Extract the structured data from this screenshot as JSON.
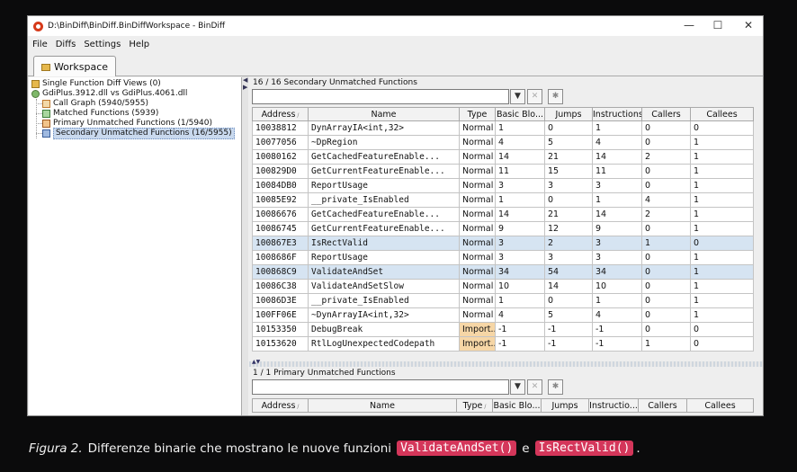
{
  "window": {
    "title": "D:\\BinDiff\\BinDiff.BinDiffWorkspace - BinDiff",
    "controls": {
      "minimize": "—",
      "maximize": "☐",
      "close": "✕"
    }
  },
  "menu": [
    "File",
    "Diffs",
    "Settings",
    "Help"
  ],
  "tab": {
    "label": "Workspace"
  },
  "tree": {
    "single_views": "Single Function Diff Views (0)",
    "diff_root": "GdiPlus.3912.dll vs GdiPlus.4061.dll",
    "call_graph": "Call Graph (5940/5955)",
    "matched": "Matched Functions (5939)",
    "primary_unmatched": "Primary Unmatched Functions (1/5940)",
    "secondary_unmatched": "Secondary Unmatched Functions (16/5955)"
  },
  "secondary_panel": {
    "title": "16 / 16 Secondary Unmatched Functions",
    "columns": [
      "Address",
      "Name",
      "Type",
      "Basic Blo...",
      "Jumps",
      "Instructions",
      "Callers",
      "Callees"
    ],
    "rows": [
      [
        "10038812",
        "DynArrayIA<int,32>",
        "Normal",
        "1",
        "0",
        "1",
        "0",
        "0"
      ],
      [
        "10077056",
        "~DpRegion",
        "Normal",
        "4",
        "5",
        "4",
        "0",
        "1"
      ],
      [
        "10080162",
        "GetCachedFeatureEnable...",
        "Normal",
        "14",
        "21",
        "14",
        "2",
        "1"
      ],
      [
        "100829D0",
        "GetCurrentFeatureEnable...",
        "Normal",
        "11",
        "15",
        "11",
        "0",
        "1"
      ],
      [
        "10084DB0",
        "ReportUsage",
        "Normal",
        "3",
        "3",
        "3",
        "0",
        "1"
      ],
      [
        "10085E92",
        "__private_IsEnabled",
        "Normal",
        "1",
        "0",
        "1",
        "4",
        "1"
      ],
      [
        "10086676",
        "GetCachedFeatureEnable...",
        "Normal",
        "14",
        "21",
        "14",
        "2",
        "1"
      ],
      [
        "10086745",
        "GetCurrentFeatureEnable...",
        "Normal",
        "9",
        "12",
        "9",
        "0",
        "1"
      ],
      [
        "100867E3",
        "IsRectValid",
        "Normal",
        "3",
        "2",
        "3",
        "1",
        "0"
      ],
      [
        "1008686F",
        "ReportUsage",
        "Normal",
        "3",
        "3",
        "3",
        "0",
        "1"
      ],
      [
        "100868C9",
        "ValidateAndSet",
        "Normal",
        "34",
        "54",
        "34",
        "0",
        "1"
      ],
      [
        "10086C38",
        "ValidateAndSetSlow",
        "Normal",
        "10",
        "14",
        "10",
        "0",
        "1"
      ],
      [
        "10086D3E",
        "__private_IsEnabled",
        "Normal",
        "1",
        "0",
        "1",
        "0",
        "1"
      ],
      [
        "100FF06E",
        "~DynArrayIA<int,32>",
        "Normal",
        "4",
        "5",
        "4",
        "0",
        "1"
      ],
      [
        "10153350",
        "DebugBreak",
        "Import...",
        "-1",
        "-1",
        "-1",
        "0",
        "0"
      ],
      [
        "10153620",
        "RtlLogUnexpectedCodepath",
        "Import...",
        "-1",
        "-1",
        "-1",
        "1",
        "0"
      ]
    ],
    "highlighted_rows": [
      8,
      10
    ]
  },
  "primary_panel": {
    "title": "1 / 1 Primary Unmatched Functions",
    "columns": [
      "Address",
      "Name",
      "Type",
      "Basic Blo...",
      "Jumps",
      "Instructio...",
      "Callers",
      "Callees"
    ]
  },
  "caption": {
    "figure": "Figura 2.",
    "text": "Differenze binarie che mostrano le nuove  funzioni",
    "code1": "ValidateAndSet()",
    "conj": "e",
    "code2": "IsRectValid()",
    "end": "."
  },
  "colors": {
    "highlight_row": "#d6e4f2",
    "import_cell": "#f6d6a6",
    "code_badge": "#d4365a"
  }
}
